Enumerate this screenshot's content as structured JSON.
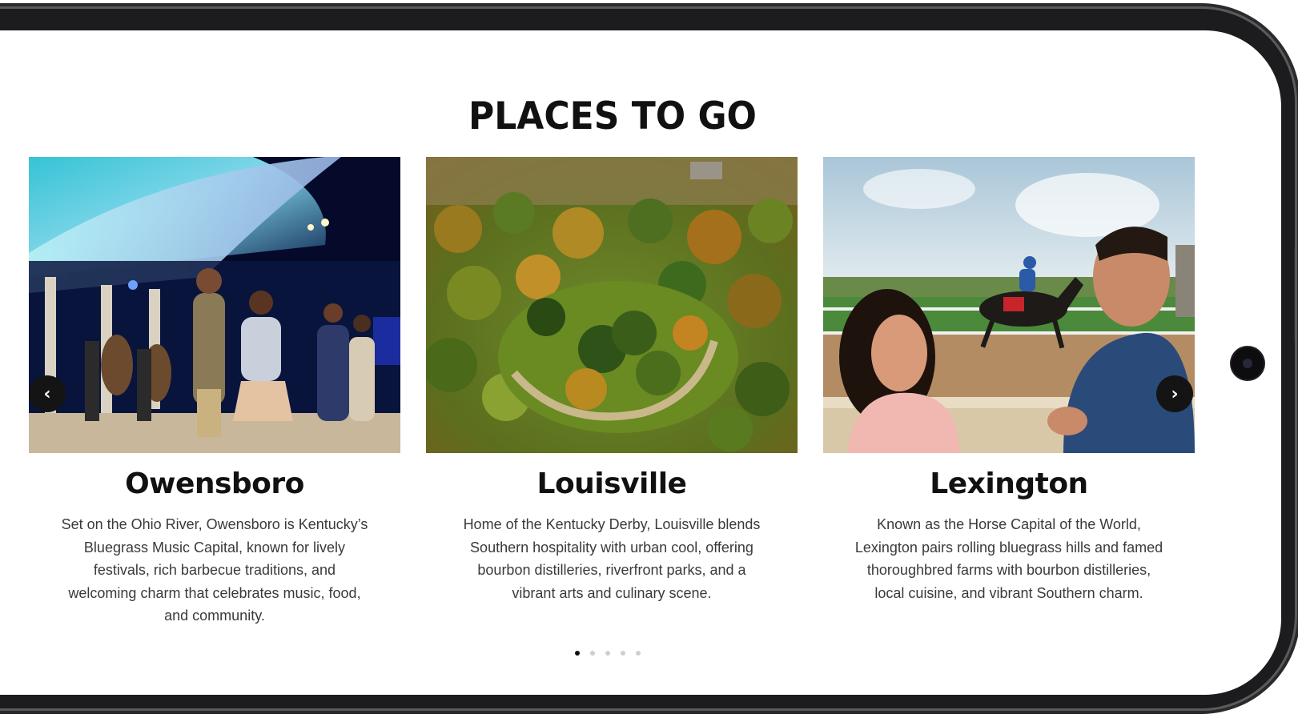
{
  "section": {
    "title": "PLACES TO GO"
  },
  "cards": [
    {
      "title": "Owensboro",
      "description": "Set on the Ohio River, Owensboro is Kentucky’s Bluegrass Music Capital, known for lively festivals, rich barbecue traditions, and welcoming charm that celebrates music, food, and community."
    },
    {
      "title": "Louisville",
      "description": "Home of the Kentucky Derby, Louisville blends Southern hospitality with urban cool, offering bourbon distilleries, riverfront parks, and a vibrant arts and culinary scene."
    },
    {
      "title": "Lexington",
      "description": "Known as the Horse Capital of the World, Lexington pairs rolling bluegrass hills and famed thoroughbred farms with bourbon distilleries, local cuisine, and vibrant Southern charm."
    }
  ],
  "carousel": {
    "prev_icon": "‹",
    "next_icon": "›",
    "dot_count": 5,
    "active_dot": 0
  },
  "colors": {
    "title": "#111111",
    "body_text": "#3a3a3a",
    "arrow_bg": "#141414",
    "dot_active": "#111111",
    "dot_inactive": "#cfcfcf",
    "phone_frame": "#1c1c1e"
  }
}
